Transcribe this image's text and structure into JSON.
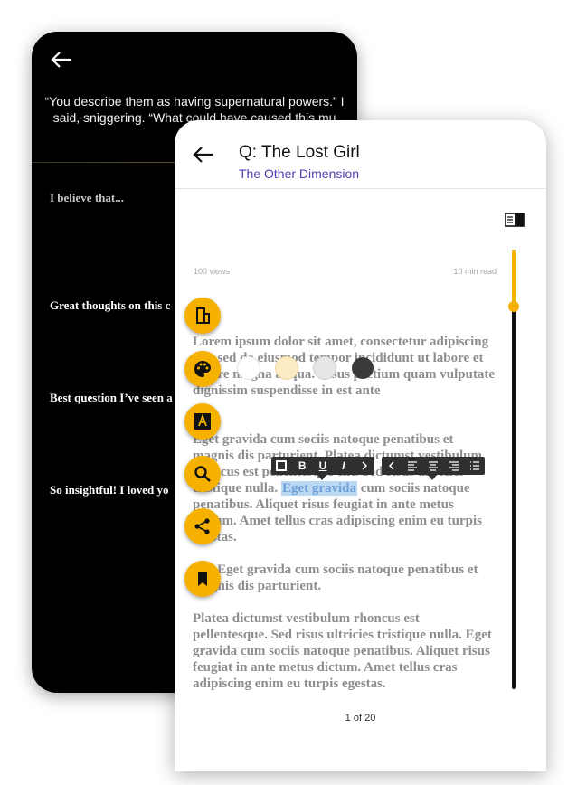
{
  "back_screen": {
    "quote": "“You describe them as having supernatural powers.” I said, sniggering. “What could have caused this mu",
    "comments": [
      "I believe that...",
      "Great thoughts on this c",
      "Best question I’ve seen a",
      "So insightful! I loved yo"
    ]
  },
  "front_screen": {
    "title": "Q: The Lost Girl",
    "subtitle": "The Other Dimension",
    "views": "100 views",
    "read_time": "10 min read",
    "paragraph1": "Lorem ipsum dolor sit amet, consectetur adipiscing elit, sed do eiusmod tempor incididunt ut labore et dolore magna aliqua. Risus pretium quam vulputate dignissim suspendisse in est ante",
    "paragraph2_before": "Eget gravida cum sociis natoque penatibus et magnis dis parturient. Platea dictumst vestibulum rhoncus est pellentesque elit. Sed risus ultricies tristique nulla.",
    "paragraph2_highlight": "Eget gravida",
    "paragraph2_after": "cum sociis natoque penatibus. Aliquet risus feugiat in ante metus dictum. Amet tellus cras adipiscing enim eu turpis egestas.",
    "paragraph3": "Sed Eget gravida cum sociis natoque penatibus et magnis dis parturient.",
    "paragraph4": "Platea dictumst vestibulum rhoncus est pellentesque. Sed risus ultricies tristique nulla. Eget gravida cum sociis natoque penatibus. Aliquet risus feugiat in ante metus dictum. Amet tellus cras adipiscing enim eu turpis egestas.",
    "page_indicator": "1 of 20",
    "reading_progress": 0.13,
    "format_toolbar": [
      "square",
      "B",
      "U",
      "I",
      "next",
      "prev",
      "align-left",
      "align-center",
      "align-right",
      "list"
    ],
    "fabs": [
      "layout-icon",
      "palette-icon",
      "font-icon",
      "search-icon",
      "share-icon",
      "bookmark-icon"
    ],
    "theme_swatches": [
      "#ffffff",
      "#fdebc3",
      "#e6e6e6",
      "#3a3a3a"
    ],
    "colors": {
      "accent": "#f6b100",
      "subtitle": "#4b3fb5",
      "highlight": "#bcd9f3"
    }
  }
}
